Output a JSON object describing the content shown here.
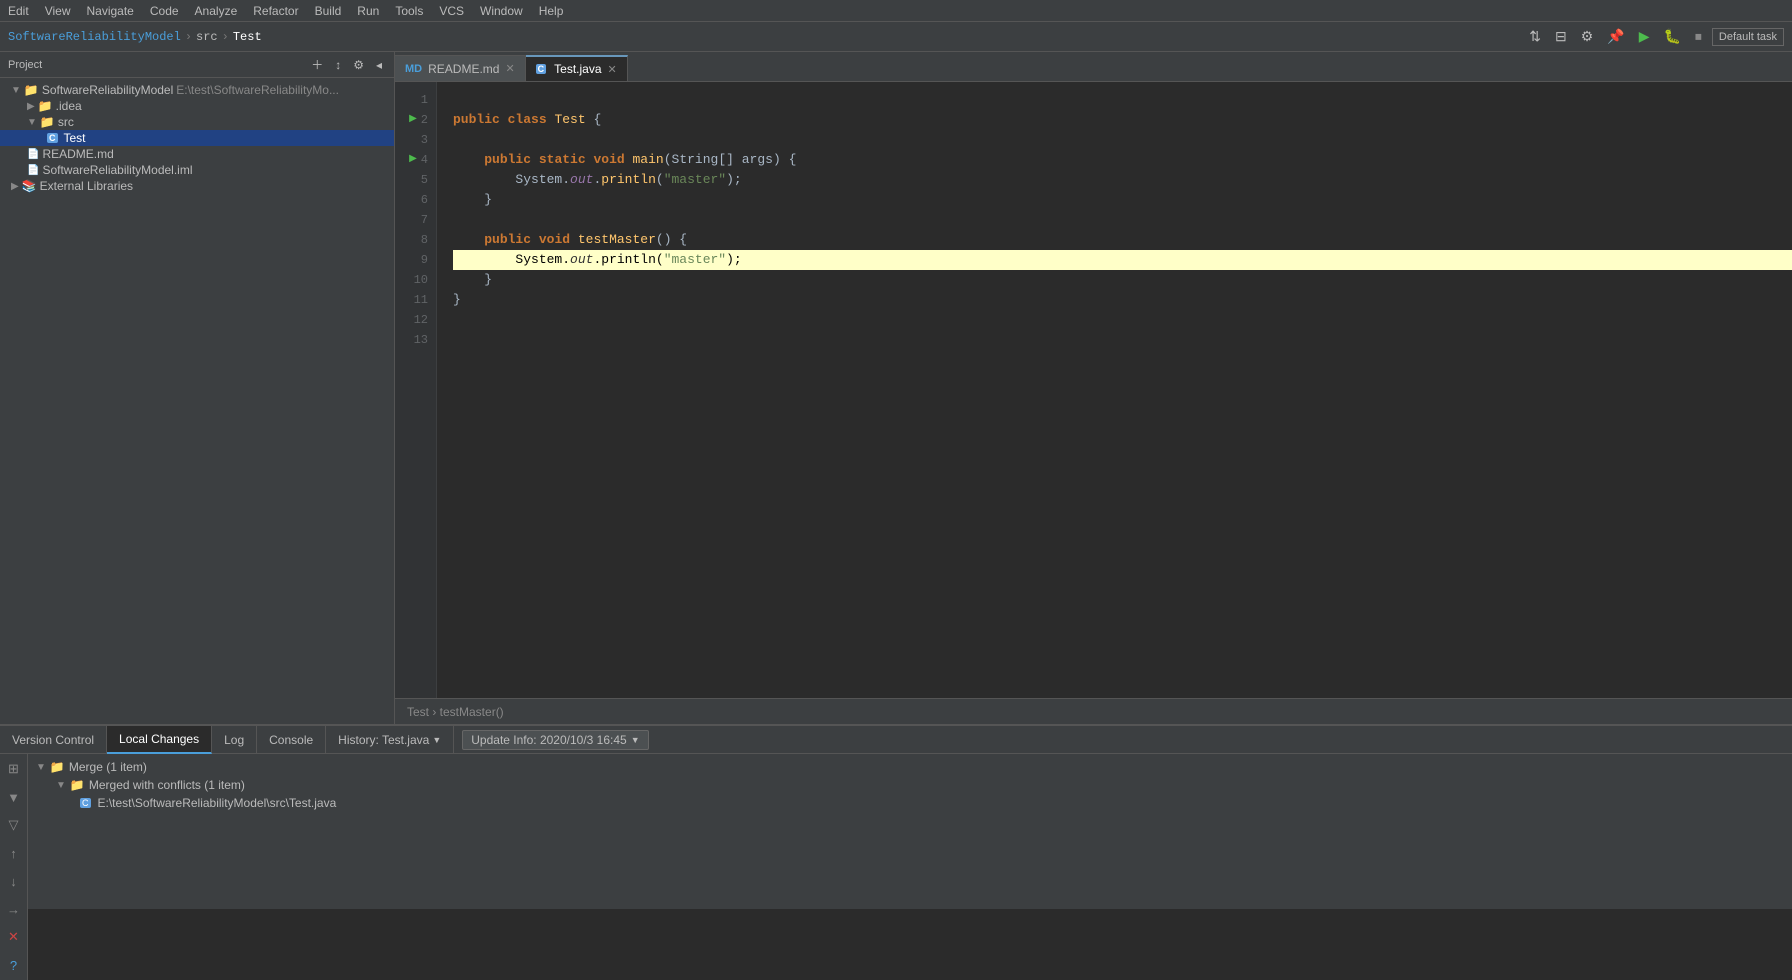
{
  "menuBar": {
    "items": [
      "Edit",
      "View",
      "Navigate",
      "Code",
      "Analyze",
      "Refactor",
      "Build",
      "Run",
      "Tools",
      "VCS",
      "Window",
      "Help"
    ]
  },
  "breadcrumb": {
    "items": [
      "SoftwareReliabilityModel",
      "src",
      "Test"
    ]
  },
  "panelHeader": "Project",
  "projectTree": {
    "root": {
      "name": "SoftwareReliabilityModel",
      "path": "E:\\test\\SoftwareReliabilityMo...",
      "children": [
        {
          "name": ".idea",
          "type": "folder"
        },
        {
          "name": "src",
          "type": "folder",
          "children": [
            {
              "name": "Test",
              "type": "java"
            }
          ]
        },
        {
          "name": "README.md",
          "type": "md"
        },
        {
          "name": "SoftwareReliabilityModel.iml",
          "type": "iml"
        },
        {
          "name": "External Libraries",
          "type": "lib"
        }
      ]
    }
  },
  "tabs": [
    {
      "id": "readme",
      "label": "README.md",
      "icon": "MD",
      "active": false
    },
    {
      "id": "testjava",
      "label": "Test.java",
      "icon": "C",
      "active": true
    }
  ],
  "code": {
    "lines": [
      {
        "n": 1,
        "text": "",
        "runBtn": false
      },
      {
        "n": 2,
        "text": "public class Test {",
        "runBtn": true
      },
      {
        "n": 3,
        "text": "",
        "runBtn": false
      },
      {
        "n": 4,
        "text": "    public static void main(String[] args) {",
        "runBtn": true
      },
      {
        "n": 5,
        "text": "        System.out.println(\"master\");",
        "runBtn": false
      },
      {
        "n": 6,
        "text": "    }",
        "runBtn": false
      },
      {
        "n": 7,
        "text": "",
        "runBtn": false
      },
      {
        "n": 8,
        "text": "    public void testMaster() {",
        "runBtn": false
      },
      {
        "n": 9,
        "text": "        System.out.println(\"master\");",
        "runBtn": false,
        "highlighted": true
      },
      {
        "n": 10,
        "text": "    }",
        "runBtn": false
      },
      {
        "n": 11,
        "text": "}",
        "runBtn": false
      },
      {
        "n": 12,
        "text": "",
        "runBtn": false
      },
      {
        "n": 13,
        "text": "",
        "runBtn": false
      }
    ]
  },
  "statusBreadcrumb": "Test › testMaster()",
  "bottomPanel": {
    "tabs": [
      {
        "id": "version-control",
        "label": "Version Control"
      },
      {
        "id": "local-changes",
        "label": "Local Changes",
        "active": true
      },
      {
        "id": "log",
        "label": "Log"
      },
      {
        "id": "console",
        "label": "Console"
      },
      {
        "id": "history",
        "label": "History: Test.java"
      }
    ],
    "updateInfo": "Update Info: 2020/10/3 16:45",
    "mergeTree": {
      "root": {
        "label": "Merge (1 item)",
        "children": [
          {
            "label": "Merged with conflicts (1 item)",
            "children": [
              {
                "label": "E:\\test\\SoftwareReliabilityModel\\src\\Test.java",
                "type": "java"
              }
            ]
          }
        ]
      }
    }
  }
}
